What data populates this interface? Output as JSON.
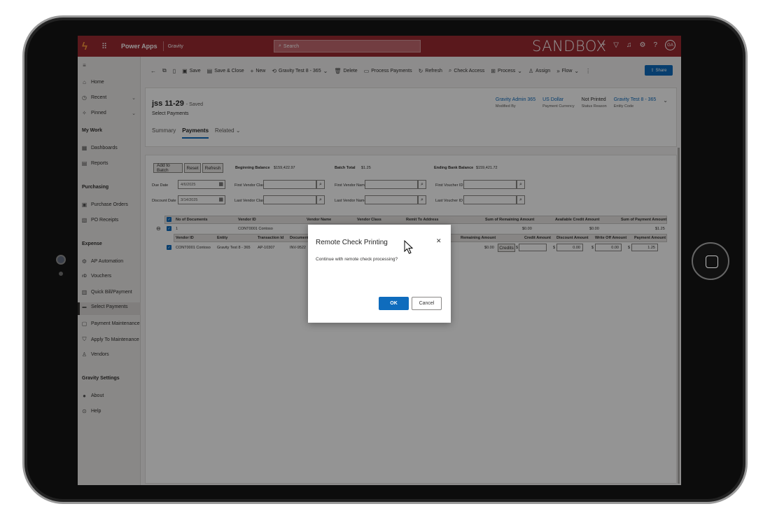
{
  "topbar": {
    "app_name": "Power Apps",
    "environment": "Gravity",
    "search_placeholder": "Search",
    "sandbox_label": "SANDBOX",
    "avatar_initials": "GA",
    "bg_color": "#9b2a31"
  },
  "sidebar": {
    "items_top": [
      {
        "label": "Home",
        "icon": "home-icon"
      },
      {
        "label": "Recent",
        "icon": "clock-icon"
      },
      {
        "label": "Pinned",
        "icon": "pin-icon"
      }
    ],
    "my_work": {
      "heading": "My Work",
      "items": [
        {
          "label": "Dashboards",
          "icon": "dashboard-icon"
        },
        {
          "label": "Reports",
          "icon": "report-icon"
        }
      ]
    },
    "purchasing": {
      "heading": "Purchasing",
      "items": [
        {
          "label": "Purchase Orders",
          "icon": "purchase-order-icon"
        },
        {
          "label": "PO Receipts",
          "icon": "receipt-icon"
        }
      ]
    },
    "expense": {
      "heading": "Expense",
      "items": [
        {
          "label": "AP Automation",
          "icon": "automation-icon"
        },
        {
          "label": "Vouchers",
          "icon": "voucher-icon"
        },
        {
          "label": "Quick Bill/Payment",
          "icon": "bill-icon"
        },
        {
          "label": "Select Payments",
          "icon": "payments-icon"
        },
        {
          "label": "Payment Maintenance",
          "icon": "maintenance-icon"
        },
        {
          "label": "Apply To Maintenance",
          "icon": "apply-icon"
        },
        {
          "label": "Vendors",
          "icon": "vendors-icon"
        }
      ]
    },
    "gravity_settings": {
      "heading": "Gravity Settings",
      "items": [
        {
          "label": "About",
          "icon": "info-icon"
        },
        {
          "label": "Help",
          "icon": "help-icon"
        }
      ]
    }
  },
  "commandbar": {
    "items": [
      "Save",
      "Save & Close",
      "New",
      "Gravity Test 8 - 365",
      "Delete",
      "Process Payments",
      "Refresh",
      "Check Access",
      "Process",
      "Assign",
      "Flow"
    ],
    "share_label": "Share"
  },
  "record": {
    "title": "jss 11-29",
    "saved_status": "- Saved",
    "entity_label": "Select Payments",
    "tabs": [
      "Summary",
      "Payments",
      "Related"
    ],
    "active_tab": "Payments",
    "header_fields": [
      {
        "value": "Gravity Admin 365",
        "label": "Modified By"
      },
      {
        "value": "US Dollar",
        "label": "Payment Currency"
      },
      {
        "value": "Not Printed",
        "label": "Status Reason"
      },
      {
        "value": "Gravity Test 8 - 365",
        "label": "Entity Code"
      }
    ]
  },
  "payments": {
    "buttons": {
      "add": "Add to Batch",
      "reset": "Reset",
      "refresh": "Refresh"
    },
    "beginning_balance_label": "Beginning Balance",
    "beginning_balance": "$159,422.97",
    "batch_total_label": "Batch Total",
    "batch_total": "$1.25",
    "ending_balance_label": "Ending Bank Balance",
    "ending_balance": "$159,421.72",
    "due_date_label": "Due Date",
    "due_date": "4/6/2025",
    "discount_date_label": "Discount Date",
    "discount_date": "3/14/2025",
    "first_vendor_class": "First Vendor Class",
    "last_vendor_class": "Last Vendor Class",
    "first_vendor_name": "First Vendor Name",
    "last_vendor_name": "Last Vendor Name",
    "first_voucher_id": "First Voucher ID",
    "last_voucher_id": "Last Voucher ID",
    "grid_headers": [
      "No of Documents",
      "Vendor ID",
      "Vendor Name",
      "Vendor Class",
      "Remit To Address",
      "Sum of Remaining Amount",
      "Available Credit Amount",
      "Sum of Payment Amount"
    ],
    "summary_row": {
      "no_docs": "1",
      "vendor_id": "CONT0001 Contoso",
      "remaining": "$0.00",
      "credit": "$0.00",
      "payment": "$1.25"
    },
    "sub_headers": [
      "Vendor ID",
      "Entity",
      "Transaction Id",
      "Document",
      "Remaining Amount",
      "Credit Amount",
      "Discount Amount",
      "Write Off Amount",
      "Payment Amount"
    ],
    "detail_row": {
      "vendor_id": "CONT0001 Contoso",
      "entity": "Gravity Test 8 - 365",
      "transaction_id": "AP-10307",
      "document": "INV-9522",
      "remaining": "$0.00",
      "credits_btn": "Credits",
      "credit": "$",
      "discount": "0.00",
      "write_off": "0.00",
      "payment": "1.25"
    }
  },
  "dialog": {
    "title": "Remote Check Printing",
    "message": "Continue with remote check processing?",
    "ok_label": "OK",
    "cancel_label": "Cancel",
    "accent": "#0f6cbd"
  }
}
